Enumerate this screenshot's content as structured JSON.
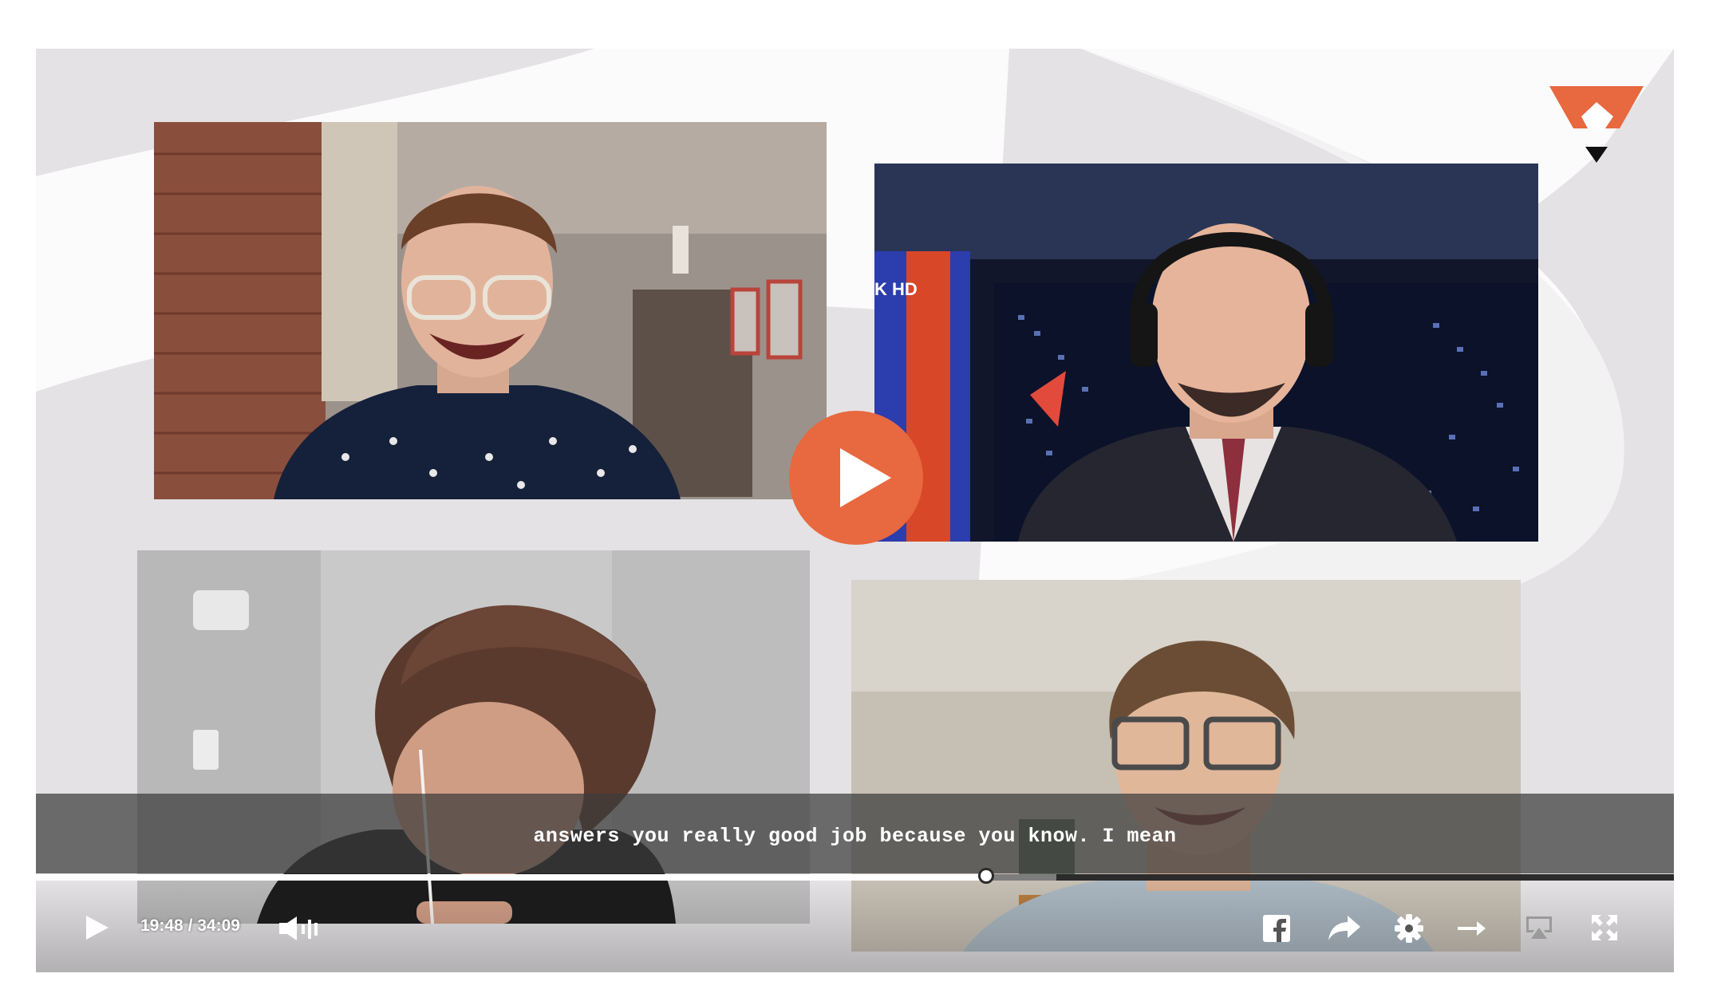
{
  "player": {
    "caption": "answers you really good job because you know. I mean",
    "time": {
      "current": "19:48",
      "separator": "/",
      "duration": "34:09"
    },
    "progress": {
      "played_fraction": 0.58,
      "buffered_fraction": 0.623
    },
    "controls": [
      "play-icon",
      "volume-icon",
      "facebook-icon",
      "share-icon",
      "gear-icon",
      "arrow-right-icon",
      "airplay-icon",
      "fullscreen-icon"
    ]
  },
  "colors": {
    "accent": "#e8683f",
    "background": "#e4e2e4",
    "caption_bar": "#3c3c3c",
    "progress_track": "#2b2b2b",
    "progress_played": "#ffffff"
  }
}
